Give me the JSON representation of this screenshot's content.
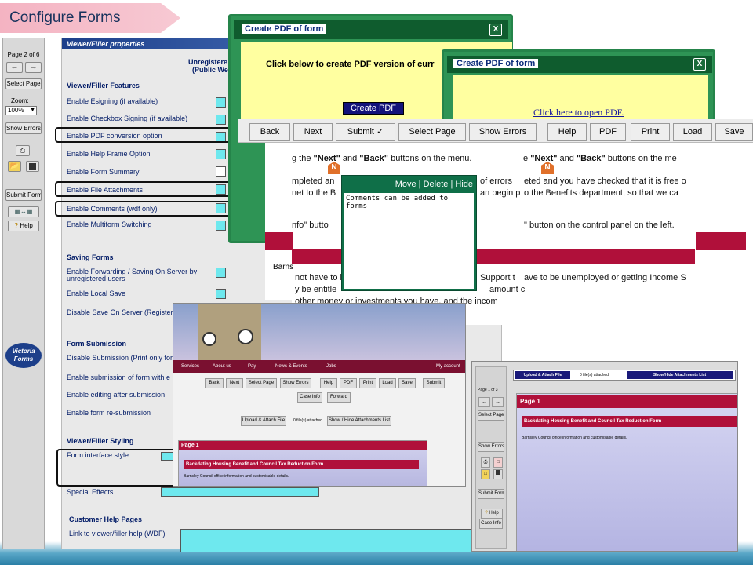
{
  "title": "Configure Forms",
  "left_panel": {
    "page_indicator": "Page 2 of 6",
    "select_page": "Select Page",
    "zoom_label": "Zoom:",
    "zoom_value": "100%",
    "show_errors": "Show Errors",
    "submit_form": "Submit Form",
    "help": "Help",
    "brand_line1": "Victoria",
    "brand_line2": "Forms"
  },
  "props": {
    "header": "Viewer/Filler properties",
    "unreg_line1": "Unregistere",
    "unreg_line2": "(Public We",
    "features_heading": "Viewer/Filler Features",
    "features": [
      "Enable Esigning (if available)",
      "Enable Checkbox Signing (if available)",
      "Enable PDF conversion option",
      "Enable Help Frame Option",
      "Enable Form Summary",
      "Enable File Attachments",
      "Enable Comments (wdf only)",
      "Enable Multiform Switching"
    ],
    "saving_heading": "Saving Forms",
    "saving_fwd1": "Enable Forwarding / Saving On Server by",
    "saving_fwd2": "unregistered users",
    "saving_local": "Enable Local Save",
    "saving_disable": "Disable Save On Server (Register",
    "submission_heading": "Form Submission",
    "sub_disable": "Disable Submission (Print only for",
    "sub_enable": "Enable submission of form with e",
    "sub_edit": "Enable editing after submission",
    "sub_resub": "Enable form re-submission",
    "styling_heading": "Viewer/Filler Styling",
    "style_interface": "Form interface style",
    "style_effects": "Special Effects",
    "help_heading": "Customer Help Pages",
    "help_link": "Link to viewer/filler help (WDF)"
  },
  "dialog1": {
    "title": "Create PDF of form",
    "close": "X",
    "message": "Click below to create PDF version of curr",
    "button": "Create PDF"
  },
  "dialog2": {
    "title": "Create PDF of form",
    "close": "X",
    "link": "Click here to open PDF."
  },
  "toolbar": {
    "back": "Back",
    "next": "Next",
    "submit": "Submit ✓",
    "select_page": "Select Page",
    "show_errors": "Show Errors",
    "help": "Help",
    "pdf": "PDF",
    "print": "Print",
    "load": "Load",
    "save": "Save"
  },
  "form_text": {
    "l1a": "g the ",
    "l1b": "\"Next\"",
    "l1c": " and ",
    "l1d": "\"Back\"",
    "l1e": " buttons on the menu.",
    "l1f": "e ",
    "l1g": "\"Next\"",
    "l1h": " and ",
    "l1i": "\"Back\"",
    "l1j": " buttons on the me",
    "l2a": "mpleted an",
    "l2b": "of errors",
    "l2c": "eted and you have checked that it is free o",
    "l3a": "net to the B",
    "l3b": "an begin p",
    "l3c": "o the Benefits department, so that we ca",
    "l4a": "nfo\" butto",
    "l4b": "\" button on the control panel on the left.",
    "barns": "Barns",
    "l5a": "not have to b",
    "l5b": "Support t",
    "l5c": "ave to be unemployed or getting Income S",
    "l6a": "y be entitle",
    "l6b": "amount c",
    "l7a": "other money or investments you have, and the incom",
    "marker": "N"
  },
  "comment": {
    "move": "Move",
    "delete": "Delete",
    "hide": "Hide",
    "sep": "|",
    "text": "Comments can be added to forms"
  },
  "site": {
    "nav": [
      "Services",
      "About us",
      "Pay",
      "News & Events",
      "Jobs",
      "My account"
    ],
    "buttons": [
      "Back",
      "Next",
      "Select Page",
      "Show Errors",
      "Help",
      "PDF",
      "Print",
      "Load",
      "Save",
      "Submit"
    ],
    "case_info": "Case Info",
    "forward": "Forward",
    "upload": "Upload & Attach File",
    "files": "0 file(s) attached",
    "showhide": "Show / Hide Attachments List",
    "page": "Page 1",
    "form_title": "Backdating Housing Benefit and Council Tax Reduction Form",
    "council": "Barnsley Council office information and customisable details."
  },
  "frame": {
    "upload": "Upload & Attach File",
    "files": "0 file(s) attached",
    "showhide": "Show/Hide Attachments List",
    "page_ind": "Page 1 of 3",
    "select_page": "Select Page",
    "show_errors": "Show Errors",
    "submit_form": "Submit Form",
    "help": "Help",
    "case_info": "Case Info",
    "page": "Page 1",
    "form_title": "Backdating Housing Benefit and Council Tax Reduction Form",
    "council": "Barnsley Council office information and customisable details."
  }
}
